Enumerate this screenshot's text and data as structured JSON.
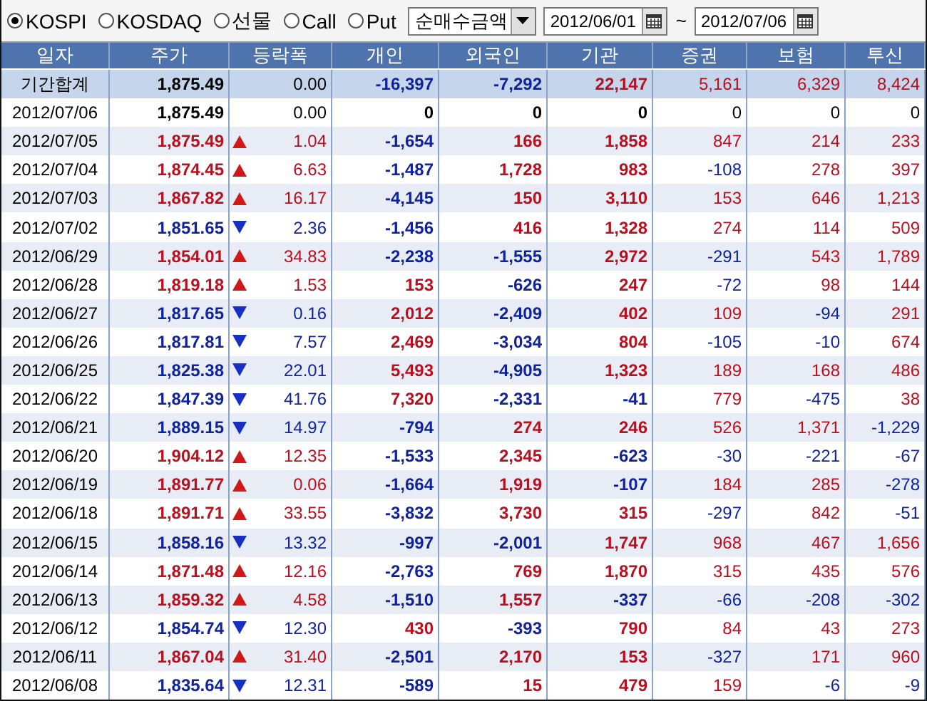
{
  "market_options": [
    {
      "label": "KOSPI",
      "selected": true
    },
    {
      "label": "KOSDAQ",
      "selected": false
    },
    {
      "label": "선물",
      "selected": false
    },
    {
      "label": "Call",
      "selected": false
    },
    {
      "label": "Put",
      "selected": false
    }
  ],
  "metric_select": {
    "value": "순매수금액"
  },
  "date_from": {
    "value": "2012/06/01"
  },
  "range_separator": "~",
  "date_to": {
    "value": "2012/07/06"
  },
  "table": {
    "columns": [
      "일자",
      "주가",
      "등락폭",
      "개인",
      "외국인",
      "기관",
      "증권",
      "보험",
      "투신"
    ],
    "rows": [
      {
        "kind": "summary",
        "date": "기간합계",
        "price": {
          "value": "1,875.49",
          "kind": "flat"
        },
        "change": "0.00",
        "cells": [
          {
            "value": "-16,397",
            "color": "#10239a"
          },
          {
            "value": "-7,292",
            "color": "#10239a"
          },
          {
            "value": "22,147",
            "color": "#b8101e"
          },
          {
            "value": "5,161",
            "color": "#b8101e"
          },
          {
            "value": "6,329",
            "color": "#b8101e"
          },
          {
            "value": "8,424",
            "color": "#b8101e"
          }
        ]
      },
      {
        "kind": "day",
        "date": "2012/07/06",
        "price": {
          "value": "1,875.49",
          "kind": "flat"
        },
        "change": "0.00",
        "cells": [
          {
            "value": "0",
            "color": "#000000"
          },
          {
            "value": "0",
            "color": "#000000"
          },
          {
            "value": "0",
            "color": "#000000"
          },
          {
            "value": "0",
            "color": "#000000"
          },
          {
            "value": "0",
            "color": "#000000"
          },
          {
            "value": "0",
            "color": "#000000"
          }
        ]
      },
      {
        "kind": "day",
        "date": "2012/07/05",
        "price": {
          "value": "1,875.49",
          "kind": "up"
        },
        "change": "1.04",
        "cells": [
          {
            "value": "-1,654",
            "color": "#10239a"
          },
          {
            "value": "166",
            "color": "#b8101e"
          },
          {
            "value": "1,858",
            "color": "#b8101e"
          },
          {
            "value": "847",
            "color": "#b8101e"
          },
          {
            "value": "214",
            "color": "#b8101e"
          },
          {
            "value": "233",
            "color": "#b8101e"
          }
        ]
      },
      {
        "kind": "day",
        "date": "2012/07/04",
        "price": {
          "value": "1,874.45",
          "kind": "up"
        },
        "change": "6.63",
        "cells": [
          {
            "value": "-1,487",
            "color": "#10239a"
          },
          {
            "value": "1,728",
            "color": "#b8101e"
          },
          {
            "value": "983",
            "color": "#b8101e"
          },
          {
            "value": "-108",
            "color": "#10239a"
          },
          {
            "value": "278",
            "color": "#b8101e"
          },
          {
            "value": "397",
            "color": "#b8101e"
          }
        ]
      },
      {
        "kind": "day",
        "date": "2012/07/03",
        "price": {
          "value": "1,867.82",
          "kind": "up"
        },
        "change": "16.17",
        "cells": [
          {
            "value": "-4,145",
            "color": "#10239a"
          },
          {
            "value": "150",
            "color": "#b8101e"
          },
          {
            "value": "3,110",
            "color": "#b8101e"
          },
          {
            "value": "153",
            "color": "#b8101e"
          },
          {
            "value": "646",
            "color": "#b8101e"
          },
          {
            "value": "1,213",
            "color": "#b8101e"
          }
        ]
      },
      {
        "kind": "day",
        "date": "2012/07/02",
        "price": {
          "value": "1,851.65",
          "kind": "down"
        },
        "change": "2.36",
        "cells": [
          {
            "value": "-1,456",
            "color": "#10239a"
          },
          {
            "value": "416",
            "color": "#b8101e"
          },
          {
            "value": "1,328",
            "color": "#b8101e"
          },
          {
            "value": "274",
            "color": "#b8101e"
          },
          {
            "value": "114",
            "color": "#b8101e"
          },
          {
            "value": "509",
            "color": "#b8101e"
          }
        ]
      },
      {
        "kind": "day",
        "date": "2012/06/29",
        "price": {
          "value": "1,854.01",
          "kind": "up"
        },
        "change": "34.83",
        "cells": [
          {
            "value": "-2,238",
            "color": "#10239a"
          },
          {
            "value": "-1,555",
            "color": "#10239a"
          },
          {
            "value": "2,972",
            "color": "#b8101e"
          },
          {
            "value": "-291",
            "color": "#10239a"
          },
          {
            "value": "543",
            "color": "#b8101e"
          },
          {
            "value": "1,789",
            "color": "#b8101e"
          }
        ]
      },
      {
        "kind": "day",
        "date": "2012/06/28",
        "price": {
          "value": "1,819.18",
          "kind": "up"
        },
        "change": "1.53",
        "cells": [
          {
            "value": "153",
            "color": "#b8101e"
          },
          {
            "value": "-626",
            "color": "#10239a"
          },
          {
            "value": "247",
            "color": "#b8101e"
          },
          {
            "value": "-72",
            "color": "#10239a"
          },
          {
            "value": "98",
            "color": "#b8101e"
          },
          {
            "value": "144",
            "color": "#b8101e"
          }
        ]
      },
      {
        "kind": "day",
        "date": "2012/06/27",
        "price": {
          "value": "1,817.65",
          "kind": "down"
        },
        "change": "0.16",
        "cells": [
          {
            "value": "2,012",
            "color": "#b8101e"
          },
          {
            "value": "-2,409",
            "color": "#10239a"
          },
          {
            "value": "402",
            "color": "#b8101e"
          },
          {
            "value": "109",
            "color": "#b8101e"
          },
          {
            "value": "-94",
            "color": "#10239a"
          },
          {
            "value": "291",
            "color": "#b8101e"
          }
        ]
      },
      {
        "kind": "day",
        "date": "2012/06/26",
        "price": {
          "value": "1,817.81",
          "kind": "down"
        },
        "change": "7.57",
        "cells": [
          {
            "value": "2,469",
            "color": "#b8101e"
          },
          {
            "value": "-3,034",
            "color": "#10239a"
          },
          {
            "value": "804",
            "color": "#b8101e"
          },
          {
            "value": "-105",
            "color": "#10239a"
          },
          {
            "value": "-10",
            "color": "#10239a"
          },
          {
            "value": "674",
            "color": "#b8101e"
          }
        ]
      },
      {
        "kind": "day",
        "date": "2012/06/25",
        "price": {
          "value": "1,825.38",
          "kind": "down"
        },
        "change": "22.01",
        "cells": [
          {
            "value": "5,493",
            "color": "#b8101e"
          },
          {
            "value": "-4,905",
            "color": "#10239a"
          },
          {
            "value": "1,323",
            "color": "#b8101e"
          },
          {
            "value": "189",
            "color": "#b8101e"
          },
          {
            "value": "168",
            "color": "#b8101e"
          },
          {
            "value": "486",
            "color": "#b8101e"
          }
        ]
      },
      {
        "kind": "day",
        "date": "2012/06/22",
        "price": {
          "value": "1,847.39",
          "kind": "down"
        },
        "change": "41.76",
        "cells": [
          {
            "value": "7,320",
            "color": "#b8101e"
          },
          {
            "value": "-2,331",
            "color": "#10239a"
          },
          {
            "value": "-41",
            "color": "#10239a"
          },
          {
            "value": "779",
            "color": "#b8101e"
          },
          {
            "value": "-475",
            "color": "#10239a"
          },
          {
            "value": "38",
            "color": "#b8101e"
          }
        ]
      },
      {
        "kind": "day",
        "date": "2012/06/21",
        "price": {
          "value": "1,889.15",
          "kind": "down"
        },
        "change": "14.97",
        "cells": [
          {
            "value": "-794",
            "color": "#10239a"
          },
          {
            "value": "274",
            "color": "#b8101e"
          },
          {
            "value": "246",
            "color": "#b8101e"
          },
          {
            "value": "526",
            "color": "#b8101e"
          },
          {
            "value": "1,371",
            "color": "#b8101e"
          },
          {
            "value": "-1,229",
            "color": "#10239a"
          }
        ]
      },
      {
        "kind": "day",
        "date": "2012/06/20",
        "price": {
          "value": "1,904.12",
          "kind": "up"
        },
        "change": "12.35",
        "cells": [
          {
            "value": "-1,533",
            "color": "#10239a"
          },
          {
            "value": "2,345",
            "color": "#b8101e"
          },
          {
            "value": "-623",
            "color": "#10239a"
          },
          {
            "value": "-30",
            "color": "#10239a"
          },
          {
            "value": "-221",
            "color": "#10239a"
          },
          {
            "value": "-67",
            "color": "#10239a"
          }
        ]
      },
      {
        "kind": "day",
        "date": "2012/06/19",
        "price": {
          "value": "1,891.77",
          "kind": "up"
        },
        "change": "0.06",
        "cells": [
          {
            "value": "-1,664",
            "color": "#10239a"
          },
          {
            "value": "1,919",
            "color": "#b8101e"
          },
          {
            "value": "-107",
            "color": "#10239a"
          },
          {
            "value": "184",
            "color": "#b8101e"
          },
          {
            "value": "285",
            "color": "#b8101e"
          },
          {
            "value": "-278",
            "color": "#10239a"
          }
        ]
      },
      {
        "kind": "day",
        "date": "2012/06/18",
        "price": {
          "value": "1,891.71",
          "kind": "up"
        },
        "change": "33.55",
        "cells": [
          {
            "value": "-3,832",
            "color": "#10239a"
          },
          {
            "value": "3,730",
            "color": "#b8101e"
          },
          {
            "value": "315",
            "color": "#b8101e"
          },
          {
            "value": "-297",
            "color": "#10239a"
          },
          {
            "value": "842",
            "color": "#b8101e"
          },
          {
            "value": "-51",
            "color": "#10239a"
          }
        ]
      },
      {
        "kind": "day",
        "date": "2012/06/15",
        "price": {
          "value": "1,858.16",
          "kind": "down"
        },
        "change": "13.32",
        "cells": [
          {
            "value": "-997",
            "color": "#10239a"
          },
          {
            "value": "-2,001",
            "color": "#10239a"
          },
          {
            "value": "1,747",
            "color": "#b8101e"
          },
          {
            "value": "968",
            "color": "#b8101e"
          },
          {
            "value": "467",
            "color": "#b8101e"
          },
          {
            "value": "1,656",
            "color": "#b8101e"
          }
        ]
      },
      {
        "kind": "day",
        "date": "2012/06/14",
        "price": {
          "value": "1,871.48",
          "kind": "up"
        },
        "change": "12.16",
        "cells": [
          {
            "value": "-2,763",
            "color": "#10239a"
          },
          {
            "value": "769",
            "color": "#b8101e"
          },
          {
            "value": "1,870",
            "color": "#b8101e"
          },
          {
            "value": "315",
            "color": "#b8101e"
          },
          {
            "value": "435",
            "color": "#b8101e"
          },
          {
            "value": "576",
            "color": "#b8101e"
          }
        ]
      },
      {
        "kind": "day",
        "date": "2012/06/13",
        "price": {
          "value": "1,859.32",
          "kind": "up"
        },
        "change": "4.58",
        "cells": [
          {
            "value": "-1,510",
            "color": "#10239a"
          },
          {
            "value": "1,557",
            "color": "#b8101e"
          },
          {
            "value": "-337",
            "color": "#10239a"
          },
          {
            "value": "-66",
            "color": "#10239a"
          },
          {
            "value": "-208",
            "color": "#10239a"
          },
          {
            "value": "-302",
            "color": "#10239a"
          }
        ]
      },
      {
        "kind": "day",
        "date": "2012/06/12",
        "price": {
          "value": "1,854.74",
          "kind": "down"
        },
        "change": "12.30",
        "cells": [
          {
            "value": "430",
            "color": "#b8101e"
          },
          {
            "value": "-393",
            "color": "#10239a"
          },
          {
            "value": "790",
            "color": "#b8101e"
          },
          {
            "value": "84",
            "color": "#b8101e"
          },
          {
            "value": "43",
            "color": "#b8101e"
          },
          {
            "value": "273",
            "color": "#b8101e"
          }
        ]
      },
      {
        "kind": "day",
        "date": "2012/06/11",
        "price": {
          "value": "1,867.04",
          "kind": "up"
        },
        "change": "31.40",
        "cells": [
          {
            "value": "-2,501",
            "color": "#10239a"
          },
          {
            "value": "2,170",
            "color": "#b8101e"
          },
          {
            "value": "153",
            "color": "#b8101e"
          },
          {
            "value": "-327",
            "color": "#10239a"
          },
          {
            "value": "171",
            "color": "#b8101e"
          },
          {
            "value": "960",
            "color": "#b8101e"
          }
        ]
      },
      {
        "kind": "day",
        "date": "2012/06/08",
        "price": {
          "value": "1,835.64",
          "kind": "down"
        },
        "change": "12.31",
        "cells": [
          {
            "value": "-589",
            "color": "#10239a"
          },
          {
            "value": "15",
            "color": "#b8101e"
          },
          {
            "value": "479",
            "color": "#b8101e"
          },
          {
            "value": "159",
            "color": "#b8101e"
          },
          {
            "value": "-6",
            "color": "#10239a"
          },
          {
            "value": "-9",
            "color": "#10239a"
          }
        ]
      }
    ]
  }
}
